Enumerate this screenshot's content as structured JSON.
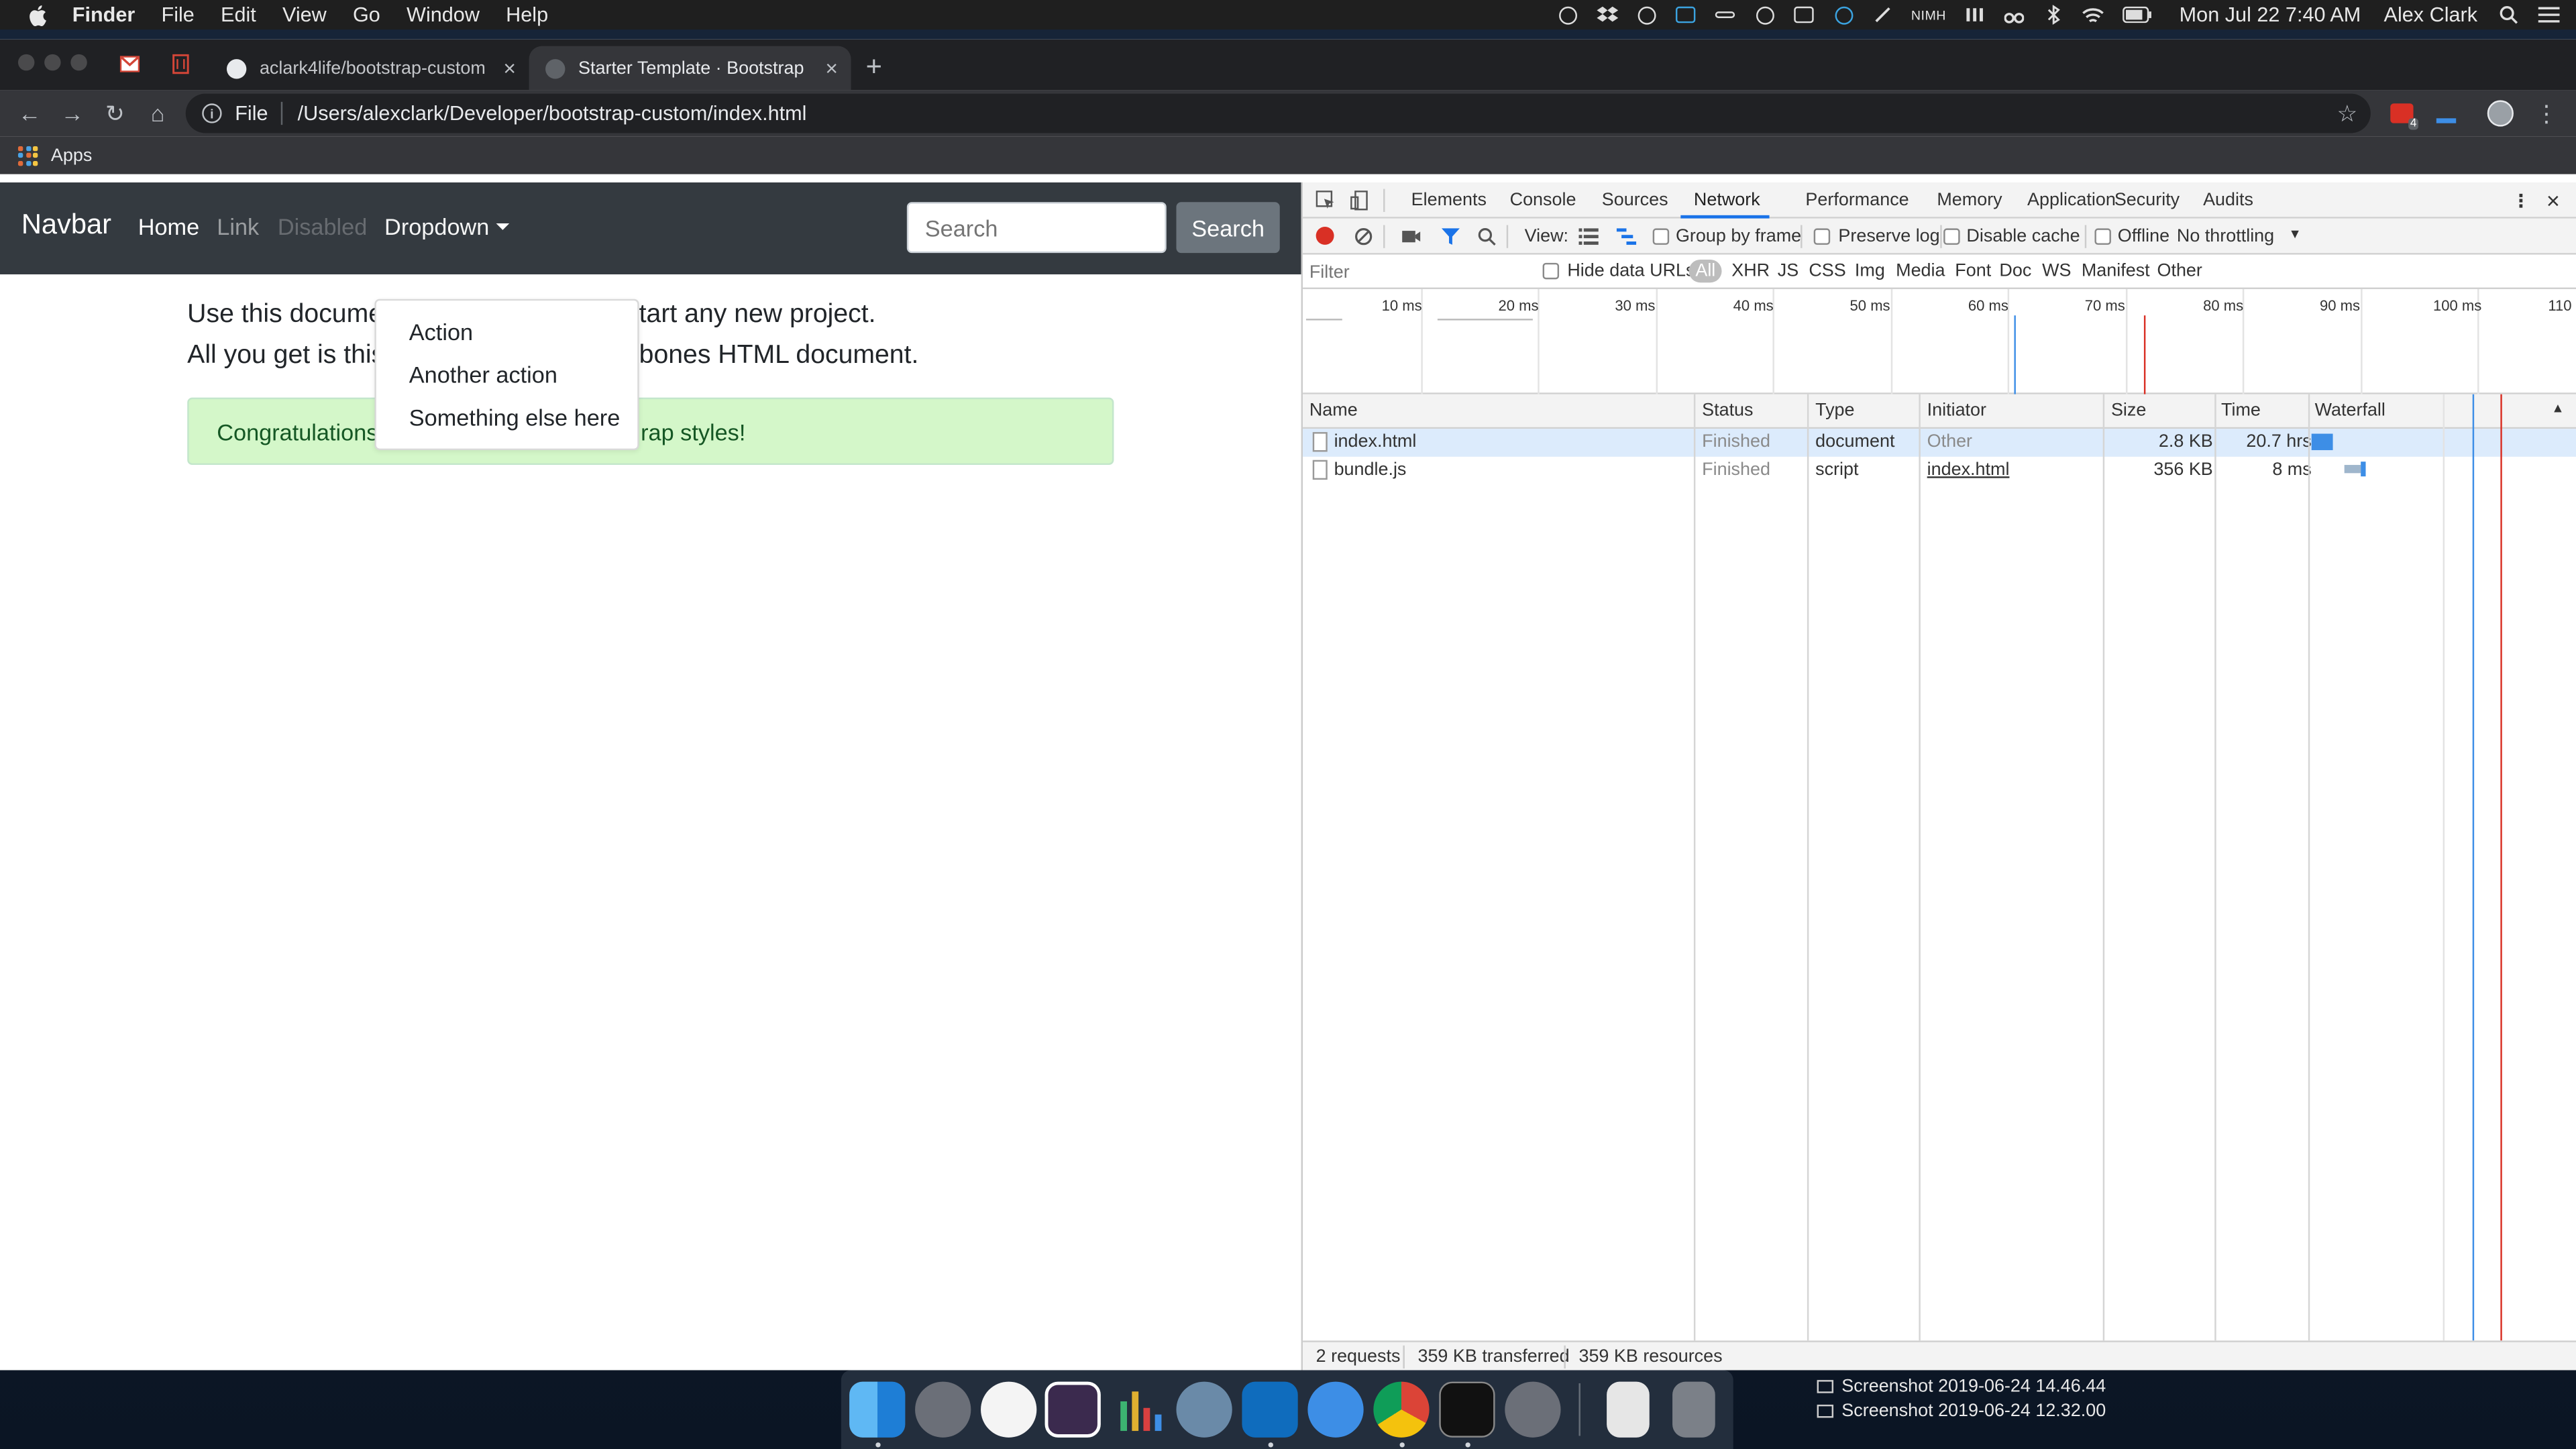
{
  "menubar": {
    "app": "Finder",
    "items": [
      "File",
      "Edit",
      "View",
      "Go",
      "Window",
      "Help"
    ],
    "nih_label": "NIMH",
    "clock": "Mon Jul 22  7:40 AM",
    "user": "Alex Clark"
  },
  "browser": {
    "tabs": [
      {
        "label": "aclark4life/bootstrap-custom"
      },
      {
        "label": "Starter Template · Bootstrap"
      }
    ],
    "omnibox": {
      "scheme": "File",
      "url": "/Users/alexclark/Developer/bootstrap-custom/index.html"
    },
    "bookmarks": {
      "apps_label": "Apps"
    },
    "extension_badge": "4"
  },
  "page": {
    "brand": "Navbar",
    "nav": {
      "home": "Home",
      "link": "Link",
      "disabled": "Disabled",
      "dropdown": "Dropdown"
    },
    "search": {
      "placeholder": "Search",
      "button": "Search"
    },
    "lead_line1_a": "Use this docume",
    "lead_line1_b": "tart any new project.",
    "lead_line2_a": "All you get is this",
    "lead_line2_b": "bones HTML document.",
    "alert_a": "Congratulations,",
    "alert_b": "rap styles!",
    "dropdown_items": [
      "Action",
      "Another action",
      "Something else here"
    ]
  },
  "devtools": {
    "tabs": [
      "Elements",
      "Console",
      "Sources",
      "Network",
      "Performance",
      "Memory",
      "Application",
      "Security",
      "Audits"
    ],
    "active_tab": "Network",
    "toolbar": {
      "view_label": "View:",
      "group_by_frame": "Group by frame",
      "preserve_log": "Preserve log",
      "disable_cache": "Disable cache",
      "offline": "Offline",
      "throttling": "No throttling"
    },
    "filter": {
      "placeholder": "Filter",
      "hide_data_urls": "Hide data URLs",
      "types": [
        "All",
        "XHR",
        "JS",
        "CSS",
        "Img",
        "Media",
        "Font",
        "Doc",
        "WS",
        "Manifest",
        "Other"
      ]
    },
    "timeline_ticks": [
      "10 ms",
      "20 ms",
      "30 ms",
      "40 ms",
      "50 ms",
      "60 ms",
      "70 ms",
      "80 ms",
      "90 ms",
      "100 ms",
      "110"
    ],
    "columns": [
      "Name",
      "Status",
      "Type",
      "Initiator",
      "Size",
      "Time",
      "Waterfall"
    ],
    "rows": [
      {
        "name": "index.html",
        "status": "Finished",
        "type": "document",
        "initiator": "Other",
        "size": "2.8 KB",
        "time": "20.7 hrs"
      },
      {
        "name": "bundle.js",
        "status": "Finished",
        "type": "script",
        "initiator": "index.html",
        "size": "356 KB",
        "time": "8 ms"
      }
    ],
    "status_bar": {
      "requests": "2 requests",
      "transferred": "359 KB transferred",
      "resources": "359 KB resources"
    }
  },
  "desktop": {
    "files": [
      "Screenshot 2019-06-24 14.46.44",
      "Screenshot 2019-06-24 12.32.00"
    ]
  },
  "colors": {
    "navbar_bg": "#343a40",
    "alert_bg": "#d4f7c9",
    "record_red": "#d93025",
    "waterfall_blue": "#3d8ee6"
  }
}
